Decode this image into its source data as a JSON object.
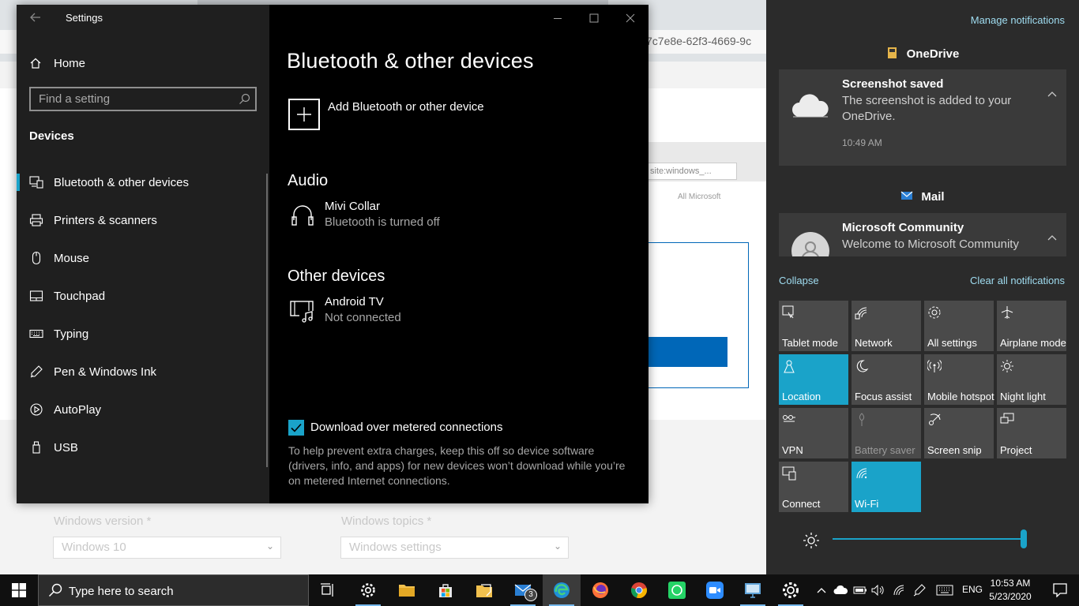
{
  "background": {
    "address_fragment": "7c7e8e-62f3-4669-9c",
    "search_fragment": "site:windows_...",
    "all_microsoft": "All Microsoft",
    "windows_version_label": "Windows version *",
    "windows_version_value": "Windows 10",
    "windows_topics_label": "Windows topics *",
    "windows_topics_value": "Windows settings"
  },
  "settings": {
    "app_title": "Settings",
    "home_label": "Home",
    "search_placeholder": "Find a setting",
    "section": "Devices",
    "nav": [
      {
        "label": "Bluetooth & other devices",
        "icon": "bluetooth-devices-icon",
        "active": true
      },
      {
        "label": "Printers & scanners",
        "icon": "printer-icon"
      },
      {
        "label": "Mouse",
        "icon": "mouse-icon"
      },
      {
        "label": "Touchpad",
        "icon": "touchpad-icon"
      },
      {
        "label": "Typing",
        "icon": "keyboard-icon"
      },
      {
        "label": "Pen & Windows Ink",
        "icon": "pen-icon"
      },
      {
        "label": "AutoPlay",
        "icon": "autoplay-icon"
      },
      {
        "label": "USB",
        "icon": "usb-icon"
      }
    ],
    "page_title": "Bluetooth & other devices",
    "add_device_label": "Add Bluetooth or other device",
    "audio_heading": "Audio",
    "audio_device": {
      "name": "Mivi Collar",
      "status": "Bluetooth is turned off"
    },
    "other_heading": "Other devices",
    "other_device": {
      "name": "Android TV",
      "status": "Not connected"
    },
    "metered_checkbox_label": "Download over metered connections",
    "metered_checked": true,
    "metered_help": "To help prevent extra charges, keep this off so device software (drivers, info, and apps) for new devices won’t download while you’re on metered Internet connections."
  },
  "action_center": {
    "manage_label": "Manage notifications",
    "group1": "OneDrive",
    "notif1": {
      "title": "Screenshot saved",
      "body": "The screenshot is added to your OneDrive.",
      "time": "10:49 AM"
    },
    "group2": "Mail",
    "notif2": {
      "title": "Microsoft Community",
      "body": "Welcome to Microsoft Community"
    },
    "collapse_label": "Collapse",
    "clear_label": "Clear all notifications",
    "tiles": [
      {
        "label": "Tablet mode",
        "icon": "tablet-mode-icon",
        "on": false
      },
      {
        "label": "Network",
        "icon": "network-icon",
        "on": false
      },
      {
        "label": "All settings",
        "icon": "gear-icon",
        "on": false
      },
      {
        "label": "Airplane mode",
        "icon": "airplane-icon",
        "on": false
      },
      {
        "label": "Location",
        "icon": "location-icon",
        "on": true
      },
      {
        "label": "Focus assist",
        "icon": "moon-icon",
        "on": false
      },
      {
        "label": "Mobile hotspot",
        "icon": "hotspot-icon",
        "on": false
      },
      {
        "label": "Night light",
        "icon": "sun-icon",
        "on": false
      },
      {
        "label": "VPN",
        "icon": "vpn-icon",
        "on": false
      },
      {
        "label": "Battery saver",
        "icon": "battery-saver-icon",
        "on": false,
        "disabled": true
      },
      {
        "label": "Screen snip",
        "icon": "screen-snip-icon",
        "on": false
      },
      {
        "label": "Project",
        "icon": "project-icon",
        "on": false
      },
      {
        "label": "Connect",
        "icon": "connect-icon",
        "on": false
      },
      {
        "label": "Wi-Fi",
        "icon": "wifi-icon",
        "on": true
      }
    ],
    "brightness": 1.0,
    "accent": "#1aa3c9"
  },
  "taskbar": {
    "search_placeholder": "Type here to search",
    "mail_badge": "3",
    "language": "ENG",
    "time": "10:53 AM",
    "date": "5/23/2020"
  }
}
